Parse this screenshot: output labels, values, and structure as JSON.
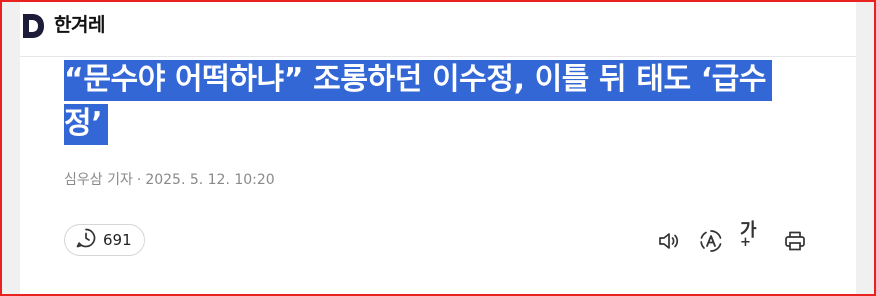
{
  "header": {
    "logo_icon": "d-logo-icon",
    "brand_name": "한겨레"
  },
  "article": {
    "headline": "“문수야 어떡하냐” 조롱하던 이수정, 이틀 뒤 태도 ‘급수정’",
    "headline_highlight_color": "#3367d6",
    "reporter": "심우삼 기자",
    "separator": "·",
    "date": "2025. 5. 12. 10:20"
  },
  "actions": {
    "comment_icon": "comment-clock-icon",
    "comment_count": "691",
    "tools": [
      {
        "name": "audio-icon"
      },
      {
        "name": "translate-icon"
      },
      {
        "name": "font-size-icon",
        "label": "가"
      },
      {
        "name": "print-icon"
      }
    ]
  }
}
